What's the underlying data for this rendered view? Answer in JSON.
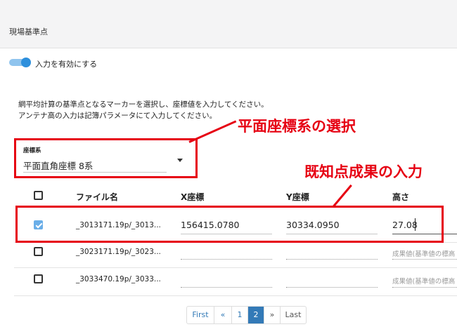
{
  "header": {
    "title": "現場基準点"
  },
  "toggle": {
    "label": "入力を有効にする",
    "enabled": true
  },
  "description": {
    "line1": "網平均計算の基準点となるマーカーを選択し、座標値を入力してください。",
    "line2": "アンテナ高の入力は記簿パラメータにて入力してください。"
  },
  "coord_system": {
    "label": "座標系",
    "value": "平面直角座標 8系"
  },
  "table": {
    "headers": {
      "file": "ファイル名",
      "x": "X座標",
      "y": "Y座標",
      "height": "高さ"
    },
    "rows": [
      {
        "checked": true,
        "file": "_3013171.19p/_3013...",
        "x": "156415.0780",
        "y": "30334.0950",
        "height": "27.08"
      },
      {
        "checked": false,
        "file": "_3023171.19p/_3023...",
        "height_placeholder": "成果値(基準値の標高"
      },
      {
        "checked": false,
        "file": "_3033470.19p/_3033...",
        "height_placeholder": "成果値(基準値の標高"
      }
    ]
  },
  "annotations": {
    "coord_callout": "平面座標系の選択",
    "known_callout": "既知点成果の入力",
    "color": "#e60012"
  },
  "pagination": {
    "first": "First",
    "prev": "«",
    "pages": [
      "1",
      "2"
    ],
    "current": "2",
    "next": "»",
    "last": "Last"
  },
  "colors": {
    "accent": "#337ab7",
    "toggle": "#2d8fdc",
    "checkbox": "#6aaee8"
  }
}
